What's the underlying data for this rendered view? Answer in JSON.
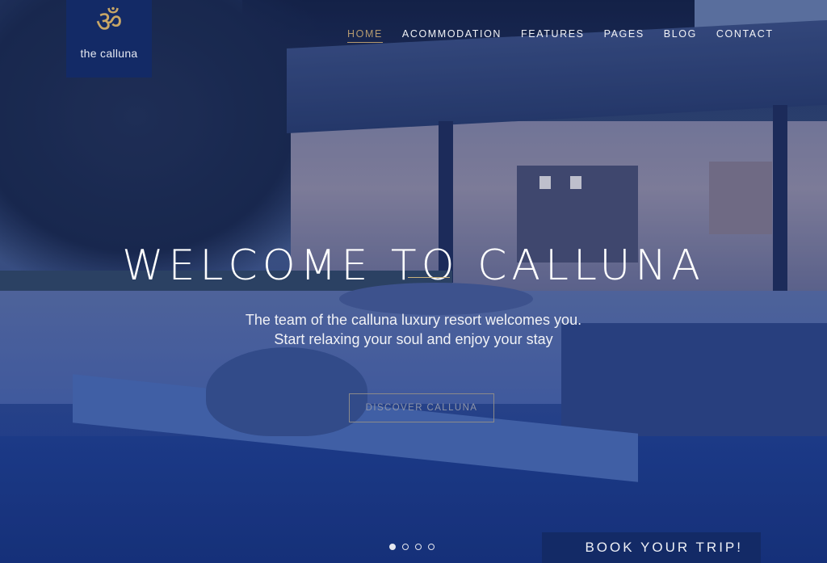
{
  "brand": {
    "logo_icon": "om-symbol-icon",
    "logo_glyph": "ॐ",
    "name": "the calluna",
    "accent_color": "#c9a766",
    "panel_color": "#132a66"
  },
  "nav": {
    "items": [
      {
        "label": "HOME",
        "active": true
      },
      {
        "label": "ACOMMODATION",
        "active": false
      },
      {
        "label": "FEATURES",
        "active": false
      },
      {
        "label": "PAGES",
        "active": false
      },
      {
        "label": "BLOG",
        "active": false
      },
      {
        "label": "CONTACT",
        "active": false
      }
    ]
  },
  "hero": {
    "title": "WELCOME TO CALLUNA",
    "subtitle_line1": "The team of the calluna luxury resort welcomes you.",
    "subtitle_line2": "Start relaxing your soul and enjoy your stay",
    "cta_label": "DISCOVER CALLUNA"
  },
  "slider": {
    "slide_count": 4,
    "active_index": 0
  },
  "booking": {
    "label": "BOOK YOUR TRIP!"
  }
}
